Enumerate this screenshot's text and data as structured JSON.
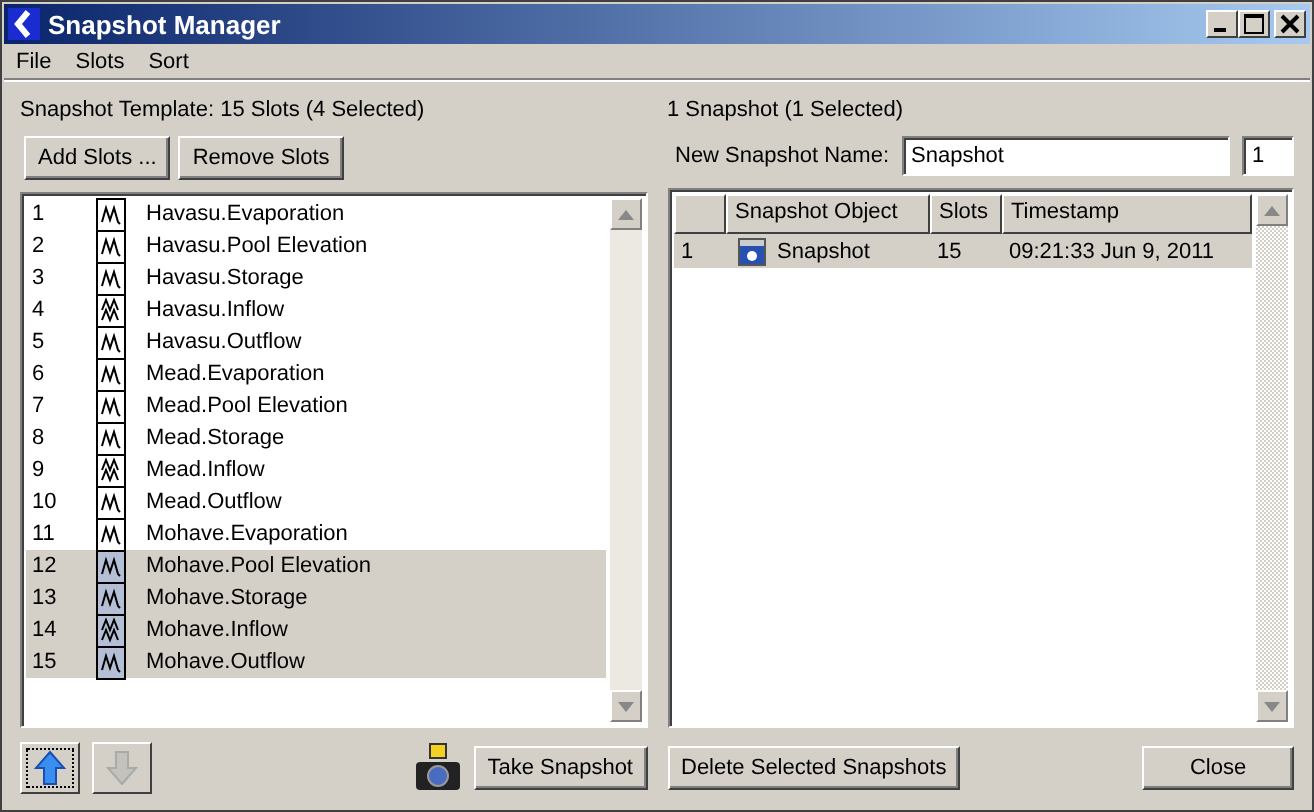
{
  "window": {
    "title": "Snapshot Manager"
  },
  "menu": [
    "File",
    "Slots",
    "Sort"
  ],
  "template": {
    "summary": "Snapshot Template: 15 Slots (4 Selected)",
    "buttons": [
      "Add Slots ...",
      "Remove Slots"
    ],
    "slots": [
      {
        "index": "1",
        "name": "Havasu.Evaporation",
        "kind": "single",
        "selected": false
      },
      {
        "index": "2",
        "name": "Havasu.Pool Elevation",
        "kind": "single",
        "selected": false
      },
      {
        "index": "3",
        "name": "Havasu.Storage",
        "kind": "single",
        "selected": false
      },
      {
        "index": "4",
        "name": "Havasu.Inflow",
        "kind": "double",
        "selected": false
      },
      {
        "index": "5",
        "name": "Havasu.Outflow",
        "kind": "single",
        "selected": false
      },
      {
        "index": "6",
        "name": "Mead.Evaporation",
        "kind": "single",
        "selected": false
      },
      {
        "index": "7",
        "name": "Mead.Pool Elevation",
        "kind": "single",
        "selected": false
      },
      {
        "index": "8",
        "name": "Mead.Storage",
        "kind": "single",
        "selected": false
      },
      {
        "index": "9",
        "name": "Mead.Inflow",
        "kind": "double",
        "selected": false
      },
      {
        "index": "10",
        "name": "Mead.Outflow",
        "kind": "single",
        "selected": false
      },
      {
        "index": "11",
        "name": "Mohave.Evaporation",
        "kind": "single",
        "selected": false
      },
      {
        "index": "12",
        "name": "Mohave.Pool Elevation",
        "kind": "single",
        "selected": true
      },
      {
        "index": "13",
        "name": "Mohave.Storage",
        "kind": "single",
        "selected": true
      },
      {
        "index": "14",
        "name": "Mohave.Inflow",
        "kind": "double",
        "selected": true
      },
      {
        "index": "15",
        "name": "Mohave.Outflow",
        "kind": "single",
        "selected": true
      }
    ],
    "move_up": {
      "disabled": false
    },
    "move_down": {
      "disabled": true
    },
    "take_button": "Take Snapshot"
  },
  "snapshots": {
    "summary": "1 Snapshot (1 Selected)",
    "name_label": "New Snapshot Name:",
    "name_value": "Snapshot",
    "count_value": "1",
    "columns": [
      "Snapshot Object",
      "Slots",
      "Timestamp"
    ],
    "rows": [
      {
        "index": "1",
        "object": "Snapshot",
        "slots": "15",
        "timestamp": "09:21:33 Jun 9, 2011",
        "selected": true
      }
    ],
    "delete_button": "Delete Selected Snapshots"
  },
  "close_button": "Close"
}
